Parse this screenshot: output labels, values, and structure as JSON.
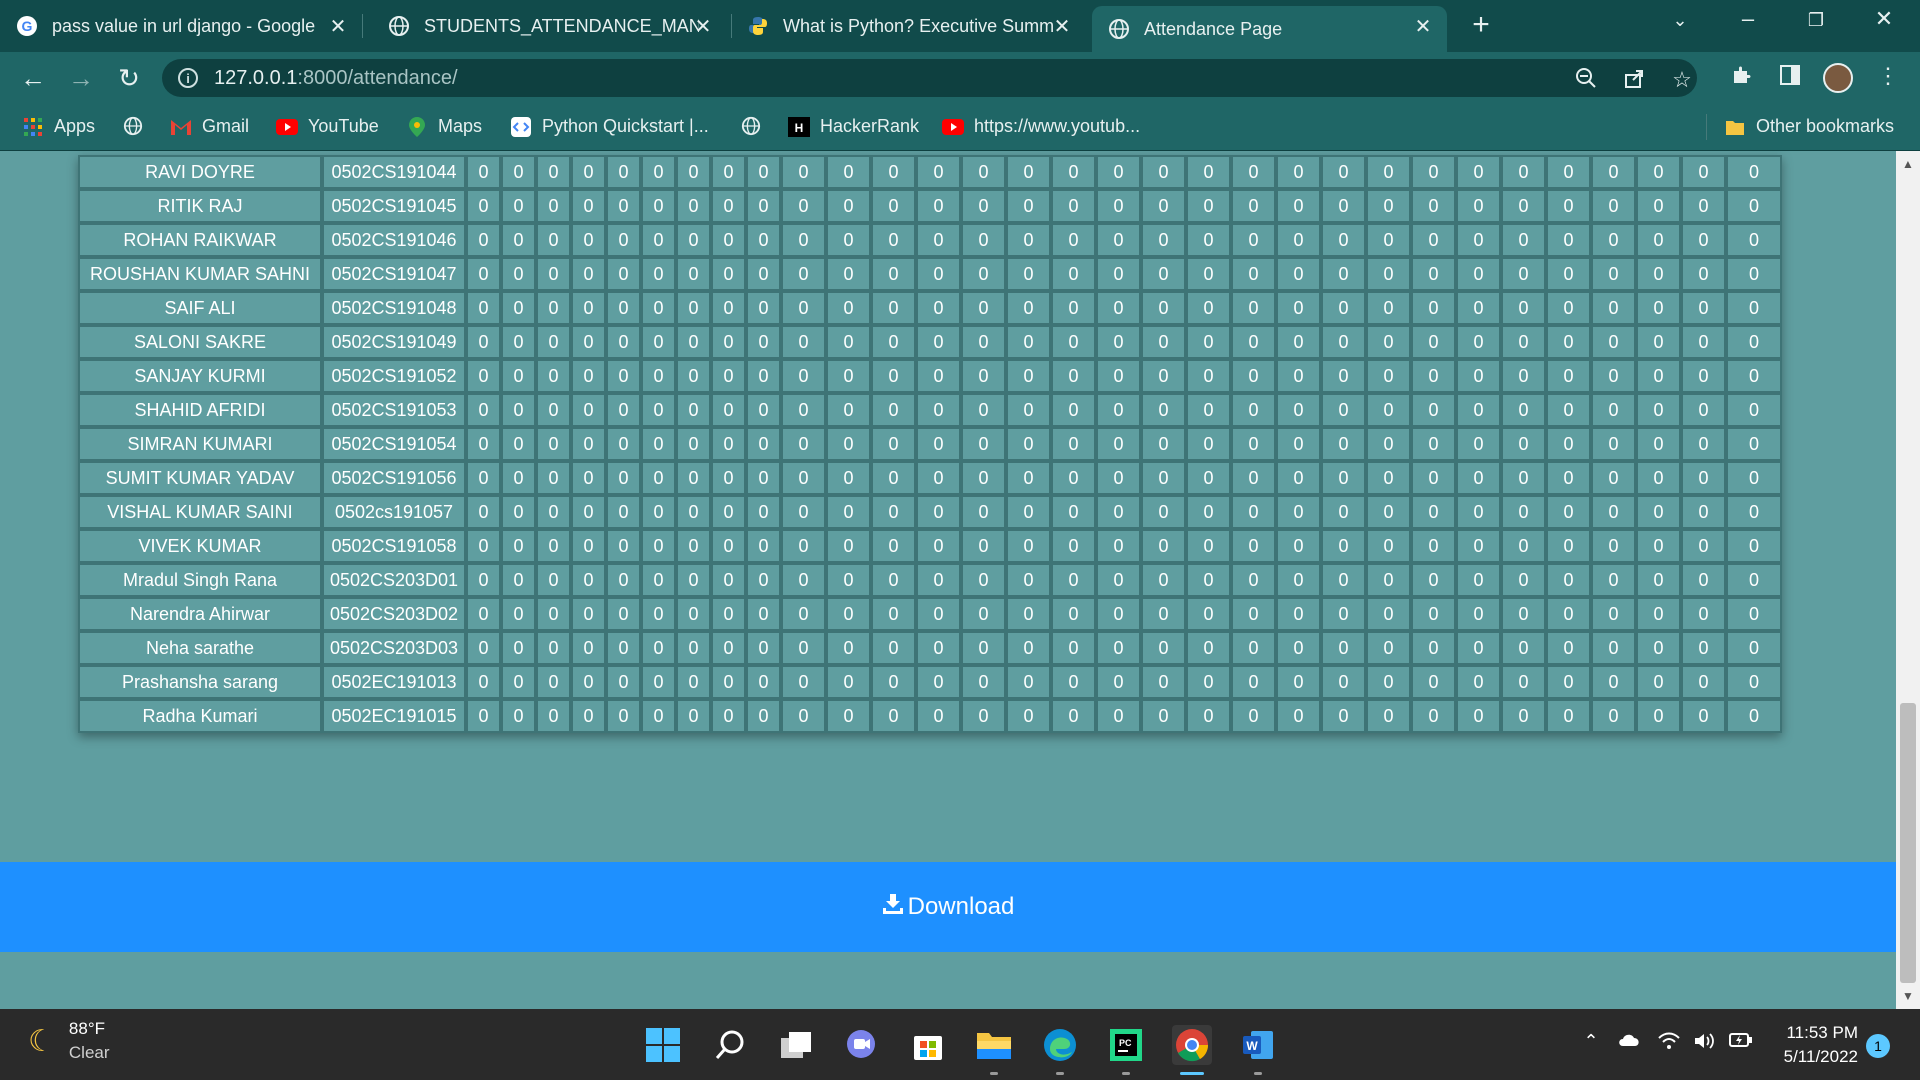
{
  "browser": {
    "tabs": [
      {
        "title": "pass value in url django - Google",
        "icon": "google-icon"
      },
      {
        "title": "STUDENTS_ATTENDANCE_MANA",
        "icon": "globe-icon"
      },
      {
        "title": "What is Python? Executive Summ",
        "icon": "python-icon"
      },
      {
        "title": "Attendance Page",
        "icon": "globe-icon",
        "active": true
      }
    ],
    "url_host": "127.0.0.1",
    "url_rest": ":8000/attendance/",
    "bookmarks": [
      "Apps",
      "Gmail",
      "YouTube",
      "Maps",
      "Python Quickstart |...",
      "HackerRank",
      "https://www.youtub...",
      "Other bookmarks"
    ]
  },
  "attendance": {
    "rows": [
      {
        "name": "RAVI DOYRE",
        "roll": "0502CS191044"
      },
      {
        "name": "RITIK RAJ",
        "roll": "0502CS191045"
      },
      {
        "name": "ROHAN RAIKWAR",
        "roll": "0502CS191046"
      },
      {
        "name": "ROUSHAN KUMAR SAHNI",
        "roll": "0502CS191047"
      },
      {
        "name": "SAIF ALI",
        "roll": "0502CS191048"
      },
      {
        "name": "SALONI SAKRE",
        "roll": "0502CS191049"
      },
      {
        "name": "SANJAY KURMI",
        "roll": "0502CS191052"
      },
      {
        "name": "SHAHID AFRIDI",
        "roll": "0502CS191053"
      },
      {
        "name": "SIMRAN KUMARI",
        "roll": "0502CS191054"
      },
      {
        "name": "SUMIT KUMAR YADAV",
        "roll": "0502CS191056"
      },
      {
        "name": "VISHAL KUMAR SAINI",
        "roll": "0502cs191057"
      },
      {
        "name": "VIVEK KUMAR",
        "roll": "0502CS191058"
      },
      {
        "name": "Mradul Singh Rana",
        "roll": "0502CS203D01"
      },
      {
        "name": "Narendra Ahirwar",
        "roll": "0502CS203D02"
      },
      {
        "name": "Neha sarathe",
        "roll": "0502CS203D03"
      },
      {
        "name": "Prashansha sarang",
        "roll": "0502EC191013"
      },
      {
        "name": "Radha Kumari",
        "roll": "0502EC191015"
      }
    ],
    "day_columns": 31,
    "cell_value": "0"
  },
  "download_label": "Download",
  "taskbar": {
    "temperature": "88°F",
    "condition": "Clear",
    "time": "11:53 PM",
    "date": "5/11/2022",
    "notifications": "1"
  },
  "colors": {
    "page_bg": "#5f9ea0",
    "download_bar": "#1e90ff",
    "chrome_frame": "#114b4b",
    "chrome_toolbar": "#1f6666"
  }
}
